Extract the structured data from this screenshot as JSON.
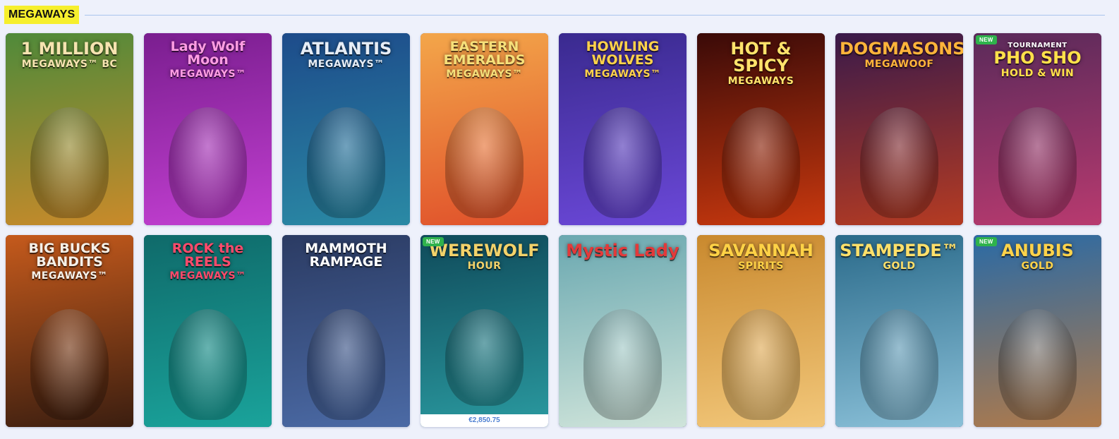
{
  "section": {
    "title": "MEGAWAYS"
  },
  "badge_new": "NEW",
  "games": [
    {
      "id": "1-million-megaways-bc",
      "line1": "1 MILLION",
      "line2": "MEGAWAYS™ BC",
      "bg": "#4f8a3a",
      "bg2": "#c98a2a",
      "logo_color": "#f6e3b0",
      "icon": "tiger"
    },
    {
      "id": "lady-wolf-moon",
      "line1": "Lady Wolf Moon",
      "line2": "MEGAWAYS™",
      "bg": "#7a1e8f",
      "bg2": "#c23fd1",
      "logo_color": "#ff9de3",
      "icon": "wolf-lady"
    },
    {
      "id": "atlantis-megaways",
      "line1": "ATLANTIS",
      "line2": "MEGAWAYS™",
      "bg": "#1d4b8a",
      "bg2": "#2a8aa5",
      "logo_color": "#e6edf6",
      "icon": "poseidon"
    },
    {
      "id": "eastern-emeralds",
      "line1": "EASTERN EMERALDS",
      "line2": "MEGAWAYS™",
      "bg": "#f3a64a",
      "bg2": "#e0502a",
      "logo_color": "#f6e07a",
      "icon": "emerald"
    },
    {
      "id": "howling-wolves",
      "line1": "HOWLING WOLVES",
      "line2": "MEGAWAYS™",
      "bg": "#3a2a8f",
      "bg2": "#6b48d8",
      "logo_color": "#ffd24a",
      "icon": "wolf"
    },
    {
      "id": "hot-spicy",
      "line1": "HOT & SPICY",
      "line2": "MEGAWAYS",
      "bg": "#3a0a08",
      "bg2": "#c8380e",
      "logo_color": "#ffe36b",
      "icon": "seven"
    },
    {
      "id": "dogmasons-megawoof",
      "line1": "DOGMASONS",
      "line2": "MEGAWOOF",
      "bg": "#3a1a4a",
      "bg2": "#b53b22",
      "logo_color": "#ffb43a",
      "icon": "dog"
    },
    {
      "id": "pho-sho",
      "line1": "PHO SHO",
      "line2": "HOLD & WIN",
      "top": "TOURNAMENT",
      "bg": "#5a2a5a",
      "bg2": "#b83a6f",
      "logo_color": "#ffe14a",
      "icon": "chef",
      "new": true
    },
    {
      "id": "big-bucks-bandits",
      "line1": "BIG BUCKS BANDITS",
      "line2": "MEGAWAYS™",
      "bg": "#c55a1c",
      "bg2": "#3b1e10",
      "logo_color": "#f5f0e8",
      "icon": "bandit"
    },
    {
      "id": "rock-the-reels",
      "line1": "ROCK the REELS",
      "line2": "MEGAWAYS™",
      "bg": "#0f6a6a",
      "bg2": "#1aa39b",
      "logo_color": "#ff4a6b",
      "icon": "boar"
    },
    {
      "id": "mammoth-rampage",
      "line1": "MAMMOTH RAMPAGE",
      "line2": "",
      "bg": "#2b3b63",
      "bg2": "#4b6aa5",
      "logo_color": "#ffffff",
      "icon": "mammoth"
    },
    {
      "id": "werewolf-hour",
      "line1": "WEREWOLF",
      "line2": "HOUR",
      "bg": "#0f4a5a",
      "bg2": "#2a9aa0",
      "logo_color": "#f2d26a",
      "icon": "werewolf",
      "new": true,
      "jackpot": "€2,850.75"
    },
    {
      "id": "mystic-lady",
      "line1": "Mystic Lady",
      "line2": "",
      "bg": "#6aa8b0",
      "bg2": "#cfe4da",
      "logo_color": "#e33a3a",
      "icon": "lady"
    },
    {
      "id": "savannah-spirits",
      "line1": "SAVANNAH",
      "line2": "SPIRITS",
      "bg": "#c9892e",
      "bg2": "#f2c77a",
      "logo_color": "#ffd246",
      "icon": "elephant"
    },
    {
      "id": "stampede-gold",
      "line1": "STAMPEDE™",
      "line2": "GOLD",
      "bg": "#2a6a8a",
      "bg2": "#8ac0d8",
      "logo_color": "#ffe06a",
      "icon": "gold-elephant"
    },
    {
      "id": "anubis-gold",
      "line1": "ANUBIS",
      "line2": "GOLD",
      "bg": "#2a6aa5",
      "bg2": "#b07a4a",
      "logo_color": "#ffd34a",
      "icon": "anubis",
      "new": true
    }
  ]
}
